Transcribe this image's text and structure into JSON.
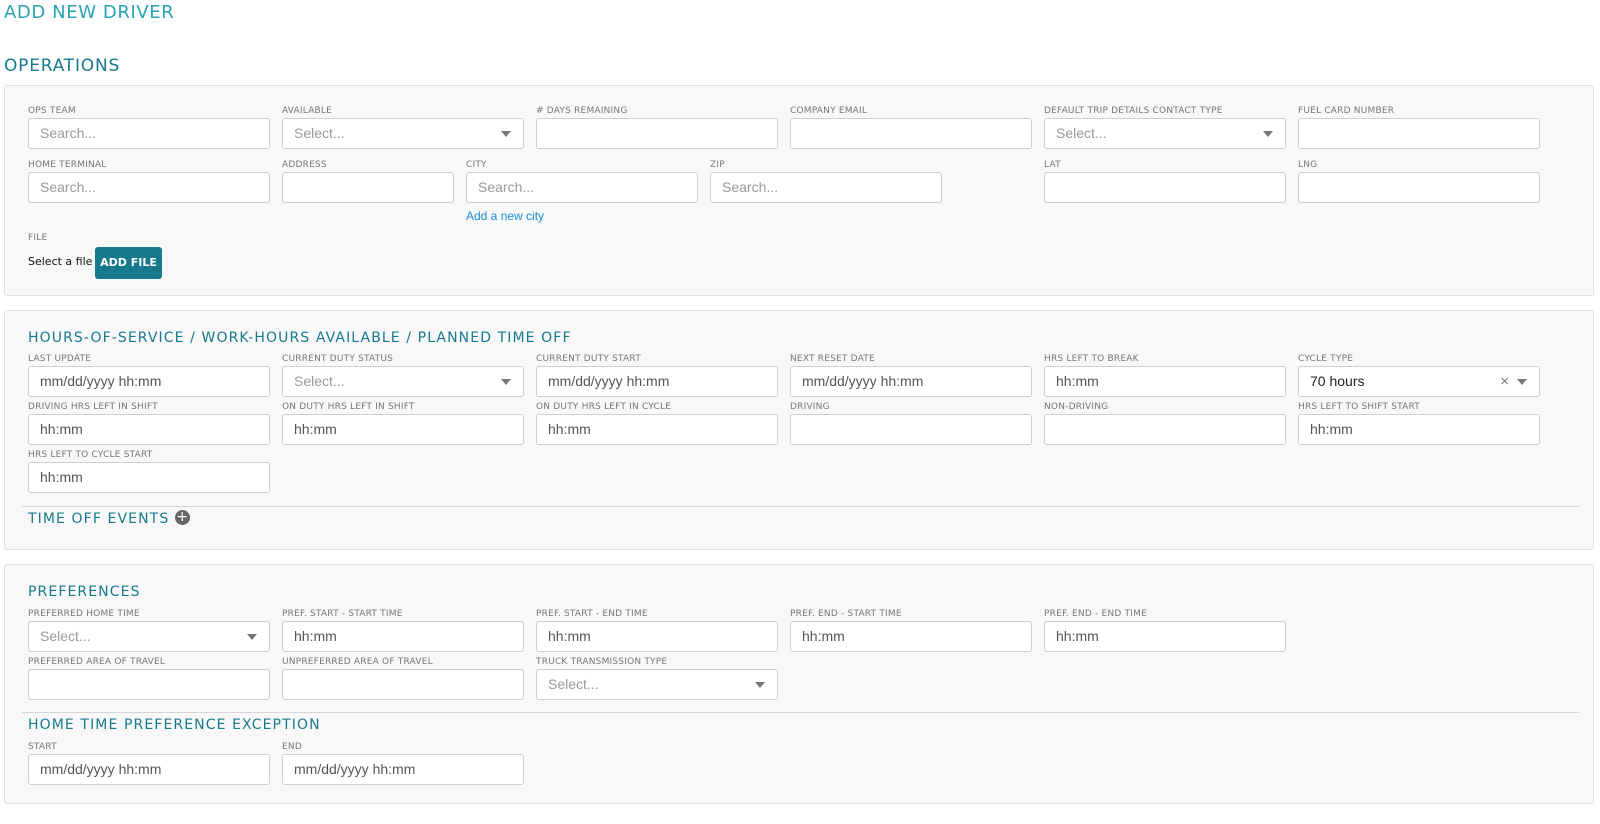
{
  "page": {
    "title": "ADD NEW DRIVER"
  },
  "operations": {
    "heading": "OPERATIONS",
    "fields": {
      "ops_team": {
        "label": "OPS TEAM",
        "placeholder": "Search..."
      },
      "available": {
        "label": "AVAILABLE",
        "placeholder": "Select..."
      },
      "days_remaining": {
        "label": "# DAYS REMAINING",
        "value": ""
      },
      "company_email": {
        "label": "COMPANY EMAIL",
        "value": ""
      },
      "default_trip_contact": {
        "label": "DEFAULT TRIP DETAILS CONTACT TYPE",
        "placeholder": "Select..."
      },
      "fuel_card_number": {
        "label": "FUEL CARD NUMBER",
        "value": ""
      },
      "home_terminal": {
        "label": "HOME TERMINAL",
        "placeholder": "Search..."
      },
      "address": {
        "label": "ADDRESS",
        "value": ""
      },
      "city": {
        "label": "CITY",
        "placeholder": "Search..."
      },
      "zip": {
        "label": "ZIP",
        "placeholder": "Search..."
      },
      "lat": {
        "label": "LAT",
        "value": ""
      },
      "lng": {
        "label": "LNG",
        "value": ""
      }
    },
    "add_city_link": "Add a new city",
    "file": {
      "label": "FILE",
      "select_text": "Select a file",
      "button": "ADD FILE"
    }
  },
  "hos": {
    "heading": "HOURS-OF-SERVICE / WORK-HOURS AVAILABLE / PLANNED TIME OFF",
    "fields": {
      "last_update": {
        "label": "LAST UPDATE",
        "placeholder": "mm/dd/yyyy hh:mm"
      },
      "current_duty_status": {
        "label": "CURRENT DUTY STATUS",
        "placeholder": "Select..."
      },
      "current_duty_start": {
        "label": "CURRENT DUTY START",
        "placeholder": "mm/dd/yyyy hh:mm"
      },
      "next_reset_date": {
        "label": "NEXT RESET DATE",
        "placeholder": "mm/dd/yyyy hh:mm"
      },
      "hrs_left_to_break": {
        "label": "HRS LEFT TO BREAK",
        "placeholder": "hh:mm"
      },
      "cycle_type": {
        "label": "CYCLE TYPE",
        "value": "70 hours"
      },
      "driving_hrs_left_shift": {
        "label": "DRIVING HRS LEFT IN SHIFT",
        "placeholder": "hh:mm"
      },
      "on_duty_hrs_left_shift": {
        "label": "ON DUTY HRS LEFT IN SHIFT",
        "placeholder": "hh:mm"
      },
      "on_duty_hrs_left_cycle": {
        "label": "ON DUTY HRS LEFT IN CYCLE",
        "placeholder": "hh:mm"
      },
      "driving": {
        "label": "DRIVING",
        "value": ""
      },
      "non_driving": {
        "label": "NON-DRIVING",
        "value": ""
      },
      "hrs_left_shift_start": {
        "label": "HRS LEFT TO SHIFT START",
        "placeholder": "hh:mm"
      },
      "hrs_left_cycle_start": {
        "label": "HRS LEFT TO CYCLE START",
        "placeholder": "hh:mm"
      }
    },
    "time_off_heading": "TIME OFF EVENTS",
    "add_icon_glyph": "+"
  },
  "preferences": {
    "heading": "PREFERENCES",
    "fields": {
      "preferred_home_time": {
        "label": "PREFERRED HOME TIME",
        "placeholder": "Select..."
      },
      "pref_start_start": {
        "label": "PREF. START - START TIME",
        "placeholder": "hh:mm"
      },
      "pref_start_end": {
        "label": "PREF. START - END TIME",
        "placeholder": "hh:mm"
      },
      "pref_end_start": {
        "label": "PREF. END - START TIME",
        "placeholder": "hh:mm"
      },
      "pref_end_end": {
        "label": "PREF. END - END TIME",
        "placeholder": "hh:mm"
      },
      "preferred_area": {
        "label": "PREFERRED AREA OF TRAVEL",
        "value": ""
      },
      "unpreferred_area": {
        "label": "UNPREFERRED AREA OF TRAVEL",
        "value": ""
      },
      "truck_transmission": {
        "label": "TRUCK TRANSMISSION TYPE",
        "placeholder": "Select..."
      }
    },
    "exception_heading": "HOME TIME PREFERENCE EXCEPTION",
    "exception": {
      "start": {
        "label": "START",
        "placeholder": "mm/dd/yyyy hh:mm"
      },
      "end": {
        "label": "END",
        "placeholder": "mm/dd/yyyy hh:mm"
      }
    }
  },
  "colors": {
    "accent": "#177a8c",
    "title": "#2aa3b5",
    "link": "#1a8cd8",
    "panel": "#f8f8f8"
  }
}
